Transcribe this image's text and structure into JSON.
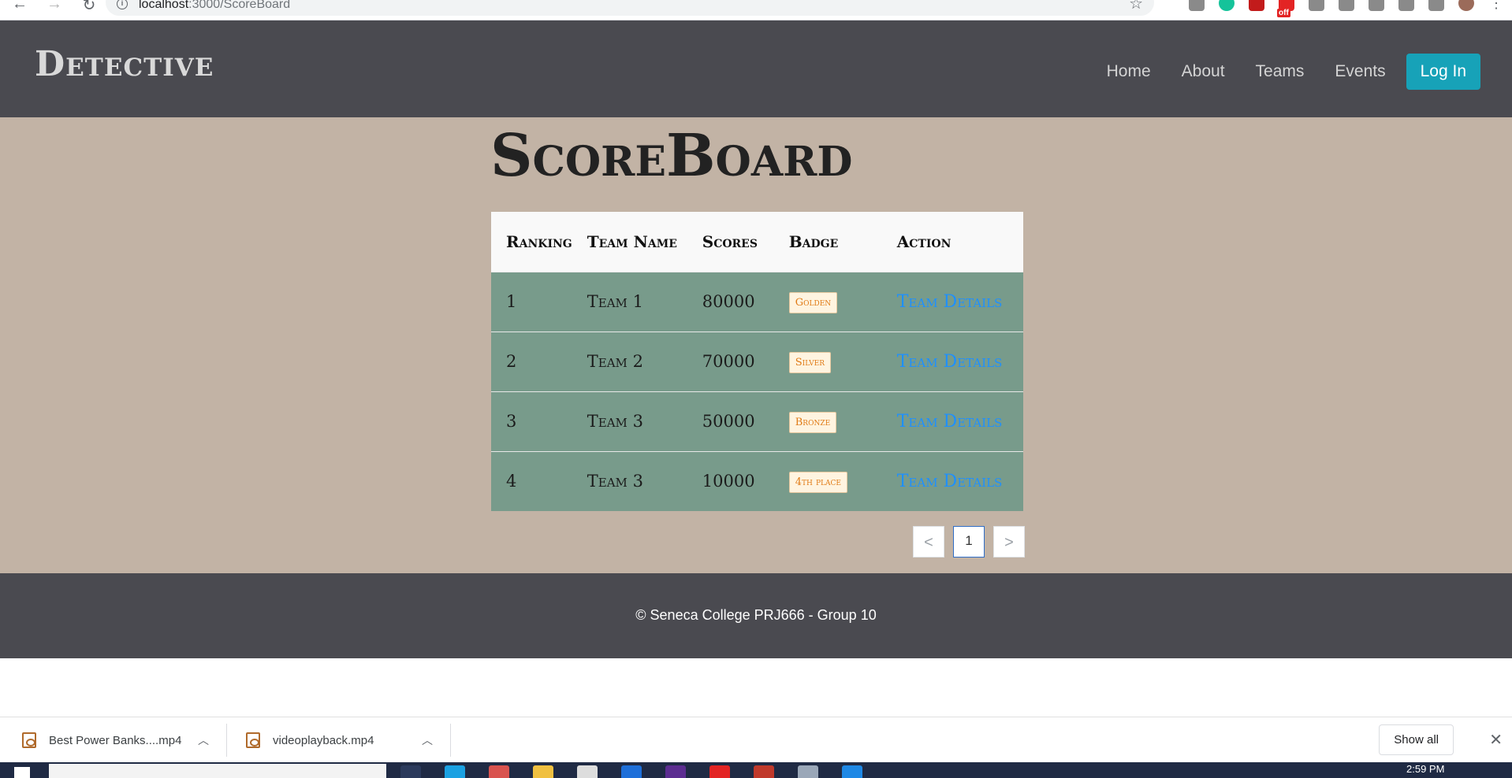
{
  "browser": {
    "nav_icons": [
      "back-icon",
      "forward-icon",
      "reload-icon"
    ],
    "url_host": "localhost",
    "url_path": ":3000/ScoreBoard",
    "extension_icons": [
      "extension-icon",
      "grammarly-icon",
      "pdf-icon",
      "off-extension-icon",
      "document-icon",
      "circle-icon",
      "cloud-icon",
      "puzzle-icon",
      "media-icon",
      "profile-avatar",
      "menu-dots-icon"
    ]
  },
  "header": {
    "logo": "Detective",
    "nav": [
      "Home",
      "About",
      "Teams",
      "Events"
    ],
    "login_label": "Log In",
    "accent": "#17a2b8",
    "background": "#4a4a50"
  },
  "main": {
    "title": "ScoreBoard",
    "background": "#c2b3a5",
    "table": {
      "headers": [
        "Ranking",
        "Team Name",
        "Scores",
        "Badge",
        "Action"
      ],
      "rows": [
        {
          "ranking": "1",
          "team": "Team 1",
          "score": "80000",
          "badge": "Golden",
          "action": "Team Details"
        },
        {
          "ranking": "2",
          "team": "Team 2",
          "score": "70000",
          "badge": "Silver",
          "action": "Team Details"
        },
        {
          "ranking": "3",
          "team": "Team 3",
          "score": "50000",
          "badge": "Bronze",
          "action": "Team Details"
        },
        {
          "ranking": "4",
          "team": "Team 3",
          "score": "10000",
          "badge": "4th place",
          "action": "Team Details"
        }
      ],
      "row_color": "#789b8b"
    },
    "pagination": {
      "prev": "<",
      "current": "1",
      "next": ">"
    }
  },
  "footer": {
    "text": "© Seneca College PRJ666 - Group 10"
  },
  "downloads": {
    "items": [
      "Best Power Banks....mp4",
      "videoplayback.mp4"
    ],
    "show_all": "Show all",
    "close": "✕"
  },
  "taskbar": {
    "time": "2:59 PM"
  }
}
